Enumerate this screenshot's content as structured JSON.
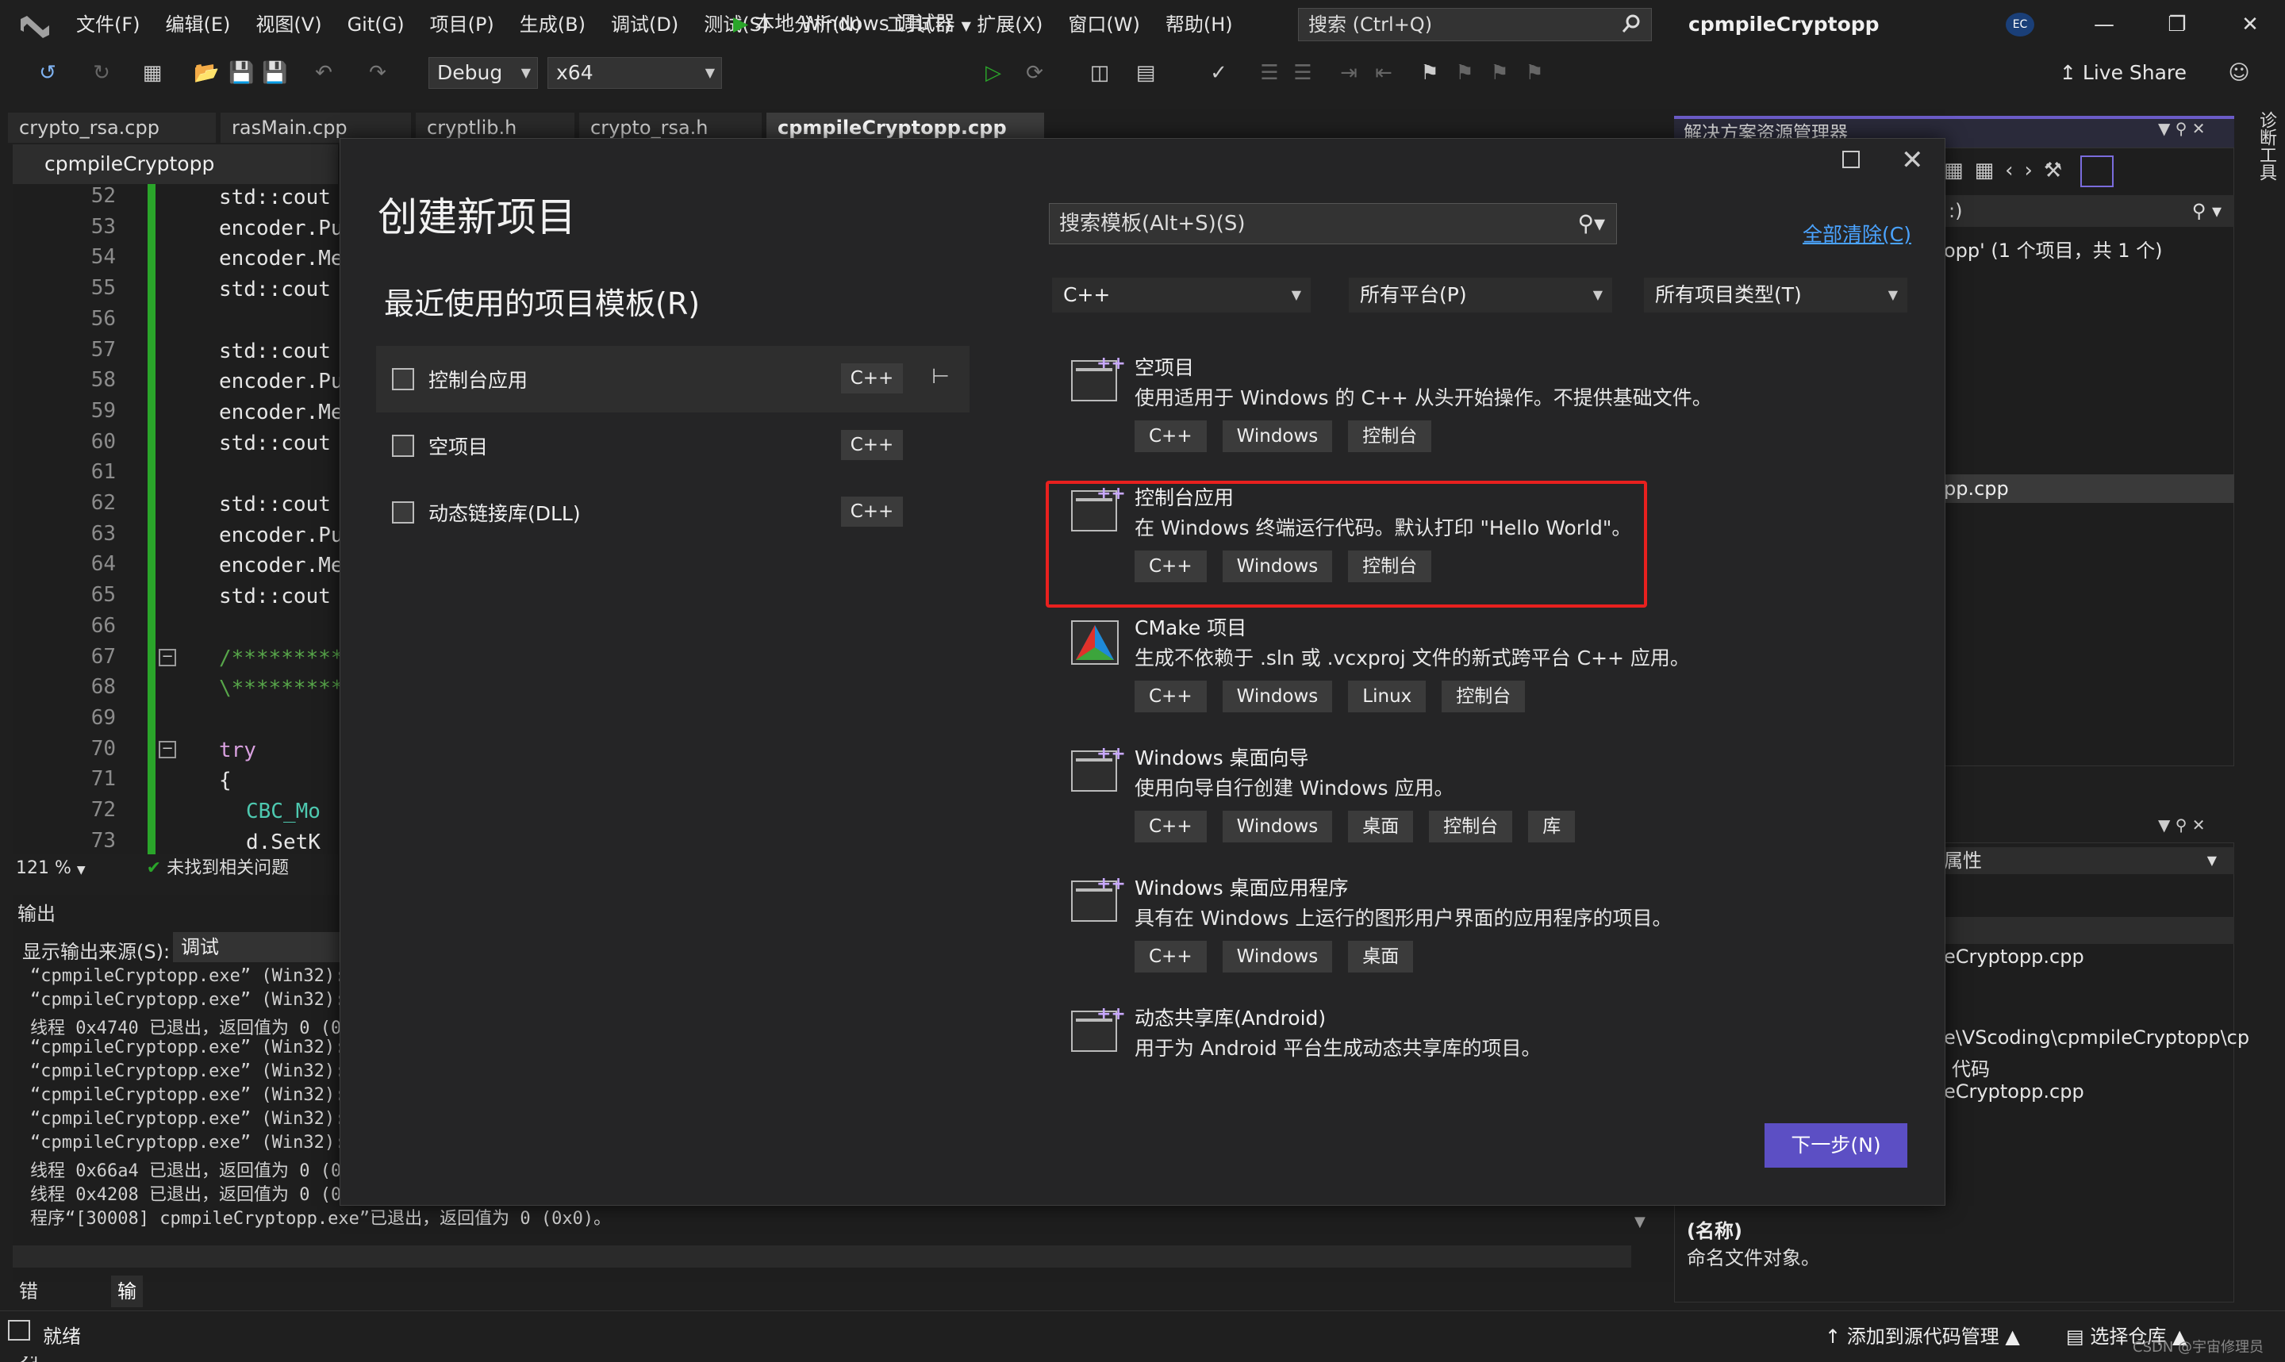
{
  "titlebar": {
    "menu": [
      "文件(F)",
      "编辑(E)",
      "视图(V)",
      "Git(G)",
      "项目(P)",
      "生成(B)",
      "调试(D)",
      "测试(S)",
      "分析(N)",
      "工具(T)",
      "扩展(X)",
      "窗口(W)",
      "帮助(H)"
    ],
    "search_placeholder": "搜索 (Ctrl+Q)",
    "app_title": "cpmpileCryptopp",
    "user_initials": "EC"
  },
  "toolbar": {
    "config": "Debug",
    "platform": "x64",
    "debugger_label": "本地 Windows 调试器",
    "live_share": "Live Share"
  },
  "doc_tabs": [
    "crypto_rsa.cpp",
    "rasMain.cpp",
    "cryptlib.h",
    "crypto_rsa.h",
    "cpmpileCryptopp.cpp"
  ],
  "editor": {
    "project": "cpmpileCryptopp",
    "line_numbers": [
      "52",
      "53",
      "54",
      "55",
      "56",
      "57",
      "58",
      "59",
      "60",
      "61",
      "62",
      "63",
      "64",
      "65",
      "66",
      "67",
      "68",
      "69",
      "70",
      "71",
      "72",
      "73"
    ],
    "code": [
      "std::cout",
      "encoder.Pu",
      "encoder.Me",
      "std::cout",
      "",
      "std::cout",
      "encoder.Pu",
      "encoder.Me",
      "std::cout",
      "",
      "std::cout",
      "encoder.Pu",
      "encoder.Me",
      "std::cout",
      "",
      "/*********",
      "\\*********",
      "",
      "try",
      "{",
      "  CBC_Mo",
      "  d.SetK"
    ],
    "zoom": "121 %",
    "issues": "未找到相关问题"
  },
  "output": {
    "title": "输出",
    "source_label": "显示输出来源(S):",
    "source_value": "调试",
    "lines": [
      "“cpmpileCryptopp.exe” (Win32):",
      "“cpmpileCryptopp.exe” (Win32):",
      "线程 0x4740 已退出，返回值为 0 (0",
      "“cpmpileCryptopp.exe” (Win32):",
      "“cpmpileCryptopp.exe” (Win32):",
      "“cpmpileCryptopp.exe” (Win32):",
      "“cpmpileCryptopp.exe” (Win32):",
      "“cpmpileCryptopp.exe” (Win32):",
      "线程 0x66a4 已退出，返回值为 0 (0",
      "线程 0x4208 已退出，返回值为 0 (0",
      "程序“[30008] cpmpileCryptopp.exe”已退出，返回值为 0 (0x0)。"
    ],
    "tabs": [
      "错误列表",
      "输出"
    ]
  },
  "solution_explorer": {
    "title": "解决方案资源管理器",
    "search_fragment": ":)",
    "result": "opp' (1 个项目，共 1 个)",
    "file": "pp.cpp"
  },
  "properties": {
    "combo": "属性",
    "rows": [
      "eCryptopp.cpp",
      "e\\VScoding\\cpmpileCryptopp\\cp",
      "代码",
      "eCryptopp.cpp"
    ],
    "desc_name": "(名称)",
    "desc_text": "命名文件对象。"
  },
  "side_tool": "诊断工具",
  "status": {
    "ready": "就绪",
    "add_source": "添加到源代码管理",
    "select_repo": "选择仓库",
    "watermark": "CSDN @宇宙修理员"
  },
  "dialog": {
    "title": "创建新项目",
    "recent_heading": "最近使用的项目模板(R)",
    "recent": [
      {
        "label": "控制台应用",
        "lang": "C++",
        "pinned": true
      },
      {
        "label": "空项目",
        "lang": "C++",
        "pinned": false
      },
      {
        "label": "动态链接库(DLL)",
        "lang": "C++",
        "pinned": false
      }
    ],
    "search_placeholder": "搜索模板(Alt+S)(S)",
    "clear_all": "全部清除(C)",
    "filters": {
      "language": "C++",
      "platform": "所有平台(P)",
      "project_type": "所有项目类型(T)"
    },
    "templates": [
      {
        "name": "空项目",
        "desc": "使用适用于 Windows 的 C++ 从头开始操作。不提供基础文件。",
        "tags": [
          "C++",
          "Windows",
          "控制台"
        ]
      },
      {
        "name": "控制台应用",
        "desc": "在 Windows 终端运行代码。默认打印 \"Hello World\"。",
        "tags": [
          "C++",
          "Windows",
          "控制台"
        ]
      },
      {
        "name": "CMake 项目",
        "desc": "生成不依赖于 .sln 或 .vcxproj 文件的新式跨平台 C++ 应用。",
        "tags": [
          "C++",
          "Windows",
          "Linux",
          "控制台"
        ]
      },
      {
        "name": "Windows 桌面向导",
        "desc": "使用向导自行创建 Windows 应用。",
        "tags": [
          "C++",
          "Windows",
          "桌面",
          "控制台",
          "库"
        ]
      },
      {
        "name": "Windows 桌面应用程序",
        "desc": "具有在 Windows 上运行的图形用户界面的应用程序的项目。",
        "tags": [
          "C++",
          "Windows",
          "桌面"
        ]
      },
      {
        "name": "动态共享库(Android)",
        "desc": "用于为 Android 平台生成动态共享库的项目。",
        "tags": []
      }
    ],
    "next_button": "下一步(N)",
    "highlight_color": "#e8201e",
    "accent_color": "#5c4fc4"
  }
}
